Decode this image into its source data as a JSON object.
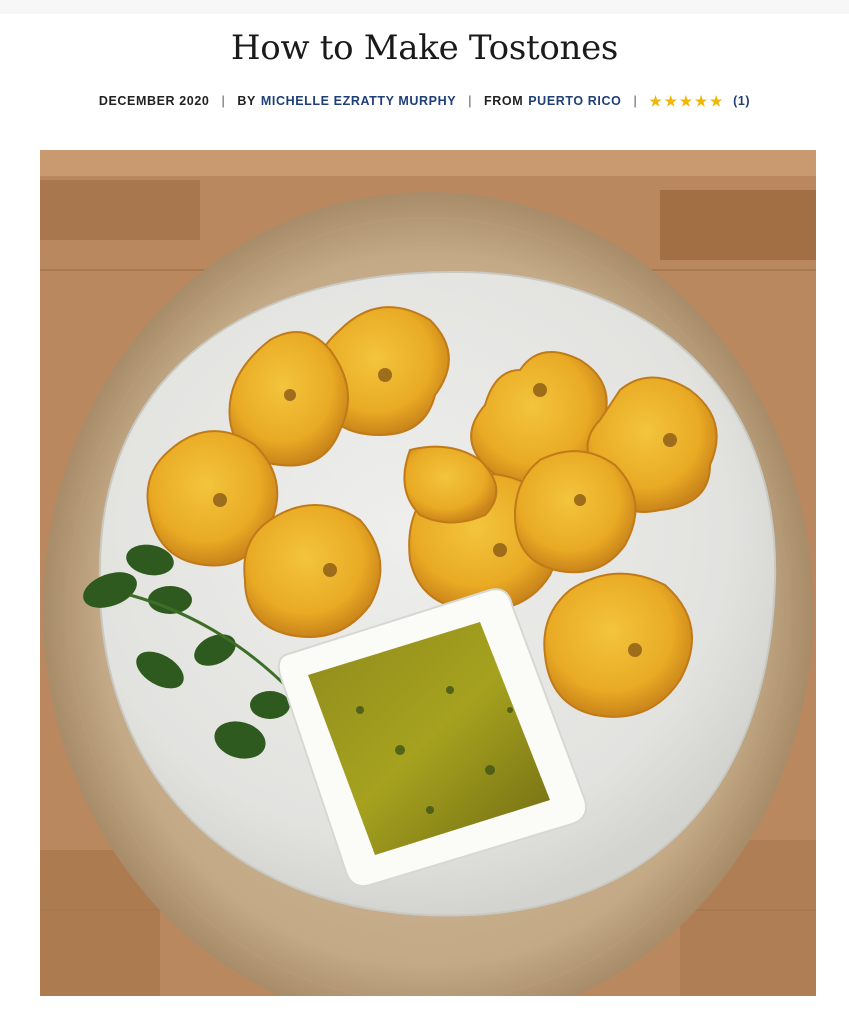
{
  "article": {
    "title": "How to Make Tostones",
    "date": "DECEMBER 2020",
    "by_prefix": "BY",
    "author": "MICHELLE EZRATTY MURPHY",
    "from_prefix": "FROM",
    "origin": "PUERTO RICO",
    "rating": {
      "stars": 5,
      "star_glyph": "★",
      "count_label": "(1)"
    },
    "separator": "|"
  },
  "colors": {
    "link": "#1f3f78",
    "star": "#f2b705"
  },
  "photo": {
    "icon": "tostones-photo-icon"
  }
}
